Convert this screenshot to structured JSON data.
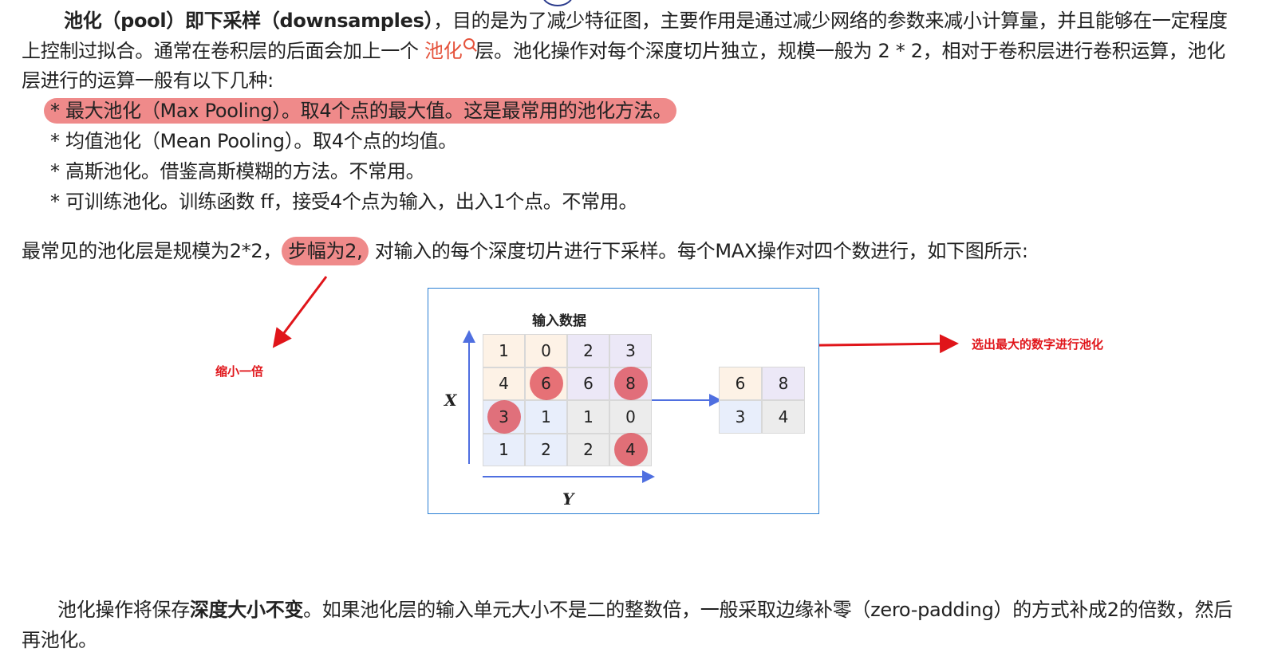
{
  "para1": {
    "t1": "池化（pool）即",
    "t2": "下采样（downsamples）",
    "t3": "，目的是为了减少特征图，主要作用是通过减少网络的参数来减小计算量，并且能够在一定程度上控制过拟合。通常在卷积层的后面会加上一个 ",
    "link": "池化",
    "t4": "层。池化操作对每个深度切片独立，规模一般为 2 * 2，相对于卷积层进行卷积运算，池化层进行的运算一般有以下几种:"
  },
  "list": [
    "* 最大池化（Max Pooling）。取4个点的最大值。这是最常用的池化方法。",
    "* 均值池化（Mean Pooling）。取4个点的均值。",
    "* 高斯池化。借鉴高斯模糊的方法。不常用。",
    "* 可训练池化。训练函数 ff，接受4个点为输入，出入1个点。不常用。"
  ],
  "para2": {
    "t1": "最常见的池化层是规模为2*2，",
    "highlight": "步幅为2,",
    "t2": " 对输入的每个深度切片进行下采样。每个MAX操作对四个数进行，如下图所示:"
  },
  "annotations": {
    "left": "缩小一倍",
    "right": "选出最大的数字进行池化"
  },
  "figure": {
    "title": "输入数据",
    "x_label": "X",
    "y_label": "Y",
    "input": [
      [
        "1",
        "0",
        "2",
        "3"
      ],
      [
        "4",
        "6",
        "6",
        "8"
      ],
      [
        "3",
        "1",
        "1",
        "0"
      ],
      [
        "1",
        "2",
        "2",
        "4"
      ]
    ],
    "output": [
      [
        "6",
        "8"
      ],
      [
        "3",
        "4"
      ]
    ],
    "colors": {
      "q1": "#fdf2e6",
      "q2": "#ece8f7",
      "q3": "#e8eefb",
      "q4": "#ececec",
      "highlight": "#de4650",
      "arrow": "#4f6fe0"
    }
  },
  "para3": {
    "t1": "池化操作将保存",
    "bold": "深度大小不变",
    "t2": "。如果池化层的输入单元大小不是二的整数倍，一般采取边缘补零（zero-padding）的方式补成2的倍数，然后再池化。"
  }
}
